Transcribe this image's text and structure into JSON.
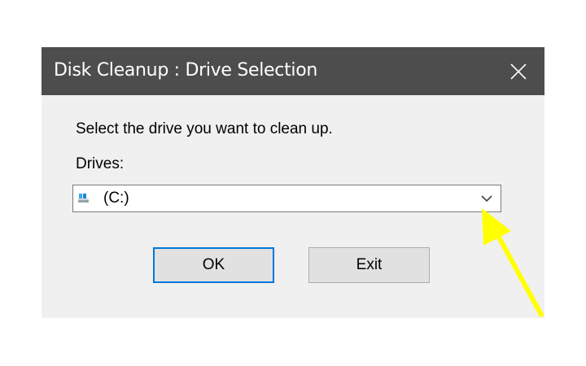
{
  "window": {
    "title": "Disk Cleanup : Drive Selection",
    "close_icon": "close-icon"
  },
  "content": {
    "prompt": "Select the drive you want to clean up.",
    "drives_label": "Drives:",
    "drive_select": {
      "selected_value": "(C:)",
      "icon": "drive-icon",
      "dropdown_icon": "chevron-down-icon"
    }
  },
  "buttons": {
    "ok_label": "OK",
    "exit_label": "Exit"
  },
  "annotation": {
    "arrow_icon": "arrow-icon",
    "color": "#ffff00"
  },
  "colors": {
    "titlebar": "#4d4d4d",
    "dialog_background": "#f0f0f0",
    "focus_border": "#0078d7"
  }
}
